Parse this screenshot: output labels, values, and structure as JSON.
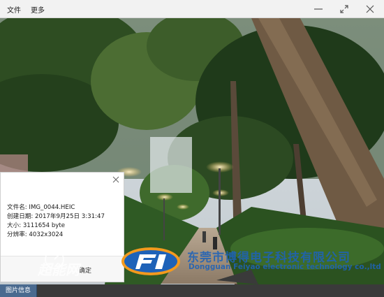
{
  "menu": {
    "file": "文件",
    "more": "更多"
  },
  "info": {
    "filename_label": "文件名:",
    "filename": "IMG_0044.HEIC",
    "created_label": "创建日期:",
    "created": "2017年9月25日 3:31:47",
    "size_label": "大小:",
    "size": "3111654 byte",
    "resolution_label": "分辨率:",
    "resolution": "4032x3024",
    "ok_label": "确定"
  },
  "bottom_tab": "图片信息",
  "watermark": {
    "left_site": "超能网",
    "brand_cn": "东莞市博得电子科技有限公司",
    "brand_en": "Dongguan Feiyao electronic technology co.,ltd"
  },
  "colors": {
    "titlebar": "#f2f2f2",
    "accent": "#1e62b8",
    "tab": "#4a6a8f"
  }
}
